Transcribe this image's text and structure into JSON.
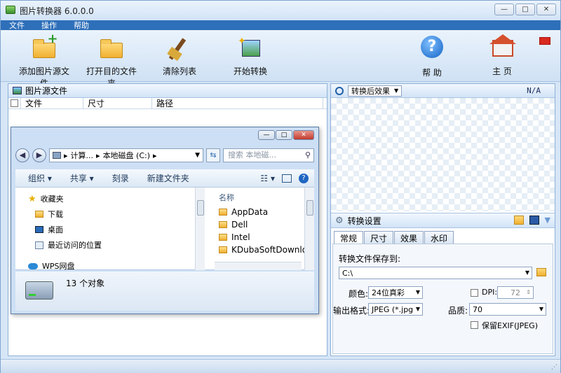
{
  "window": {
    "title": "图片转换器 6.0.0.0",
    "min": "—",
    "max": "□",
    "close": "✕"
  },
  "menu": {
    "items": [
      "文件",
      "操作",
      "帮助"
    ]
  },
  "toolbar": {
    "add_source": "添加图片源文件",
    "open_dest": "打开目的文件夹",
    "clear_list": "清除列表",
    "start": "开始转换",
    "help": "帮 助",
    "home": "主 页"
  },
  "source_panel": {
    "title": "图片源文件",
    "columns": [
      "文件",
      "尺寸",
      "路径"
    ]
  },
  "explorer": {
    "breadcrumb": [
      "计算...",
      "本地磁盘 (C:)"
    ],
    "search_placeholder": "搜索 本地磁...",
    "commands": [
      "组织 ▾",
      "共享 ▾",
      "刻录",
      "新建文件夹"
    ],
    "nav": [
      "收藏夹",
      "下载",
      "桌面",
      "最近访问的位置",
      "WPS网盘"
    ],
    "col_name": "名称",
    "files": [
      "AppData",
      "Dell",
      "Intel",
      "KDubaSoftDownloa"
    ],
    "status": "13 个对象"
  },
  "preview": {
    "dropdown": "转换后效果",
    "na": "N/A"
  },
  "settings": {
    "title": "转换设置",
    "tabs": [
      "常规",
      "尺寸",
      "效果",
      "水印"
    ],
    "save_label": "转换文件保存到:",
    "save_path": "C:\\",
    "color_label": "颜色:",
    "color_value": "24位真彩",
    "dpi_label": "DPI:",
    "dpi_value": "72",
    "format_label": "输出格式:",
    "format_value": "JPEG (*.jpg",
    "quality_label": "品质:",
    "quality_value": "70",
    "exif_label": "保留EXIF(JPEG)"
  }
}
